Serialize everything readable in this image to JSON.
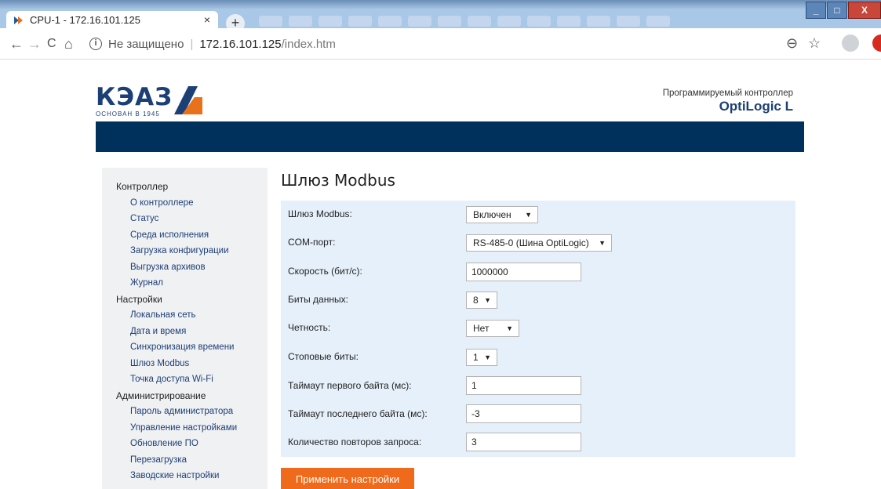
{
  "browser": {
    "tab_title": "CPU-1 - 172.16.101.125",
    "tab_close": "×",
    "new_tab": "+",
    "window_controls": {
      "minimize": "_",
      "maximize": "□",
      "close": "X"
    },
    "nav": {
      "back": "←",
      "forward": "→",
      "reload": "C",
      "home": "⌂"
    },
    "address": {
      "security_label": "Не защищено",
      "separator": "|",
      "host": "172.16.101.125",
      "path": "/index.htm"
    },
    "tools": {
      "zoom": "⊖",
      "bookmark": "☆"
    },
    "icons": [
      "back-icon",
      "forward-icon",
      "reload-icon",
      "home-icon",
      "info-icon",
      "zoom-icon",
      "star-icon",
      "avatar-icon",
      "extension-icon"
    ]
  },
  "header": {
    "logo_text": "КЭАЗ",
    "logo_subtitle": "ОСНОВАН В 1945",
    "product_caption": "Программируемый контроллер",
    "product_name": "OptiLogic L",
    "banner_color": "#00305c"
  },
  "sidebar": {
    "groups": [
      {
        "title": "Контроллер",
        "items": [
          "О контроллере",
          "Статус",
          "Среда исполнения",
          "Загрузка конфигурации",
          "Выгрузка архивов",
          "Журнал"
        ]
      },
      {
        "title": "Настройки",
        "items": [
          "Локальная сеть",
          "Дата и время",
          "Синхронизация времени",
          "Шлюз Modbus",
          "Точка доступа Wi-Fi"
        ]
      },
      {
        "title": "Администрирование",
        "items": [
          "Пароль администратора",
          "Управление настройками",
          "Обновление ПО",
          "Перезагрузка",
          "Заводские настройки"
        ]
      }
    ]
  },
  "main": {
    "title": "Шлюз Modbus",
    "fields": {
      "gateway": {
        "label": "Шлюз Modbus:",
        "value": "Включен"
      },
      "com_port": {
        "label": "COM-порт:",
        "value": "RS-485-0 (Шина OptiLogic)"
      },
      "speed": {
        "label": "Скорость (бит/с):",
        "value": "1000000"
      },
      "data_bits": {
        "label": "Биты данных:",
        "value": "8"
      },
      "parity": {
        "label": "Четность:",
        "value": "Нет"
      },
      "stop_bits": {
        "label": "Стоповые биты:",
        "value": "1"
      },
      "first_byte_timeout": {
        "label": "Таймаут первого байта (мс):",
        "value": "1"
      },
      "last_byte_timeout": {
        "label": "Таймаут последнего байта (мс):",
        "value": "-3"
      },
      "retries": {
        "label": "Количество повторов запроса:",
        "value": "3"
      }
    },
    "dropdown_arrow": "▼",
    "apply_label": "Применить настройки",
    "accent_color": "#ef6a1a"
  }
}
